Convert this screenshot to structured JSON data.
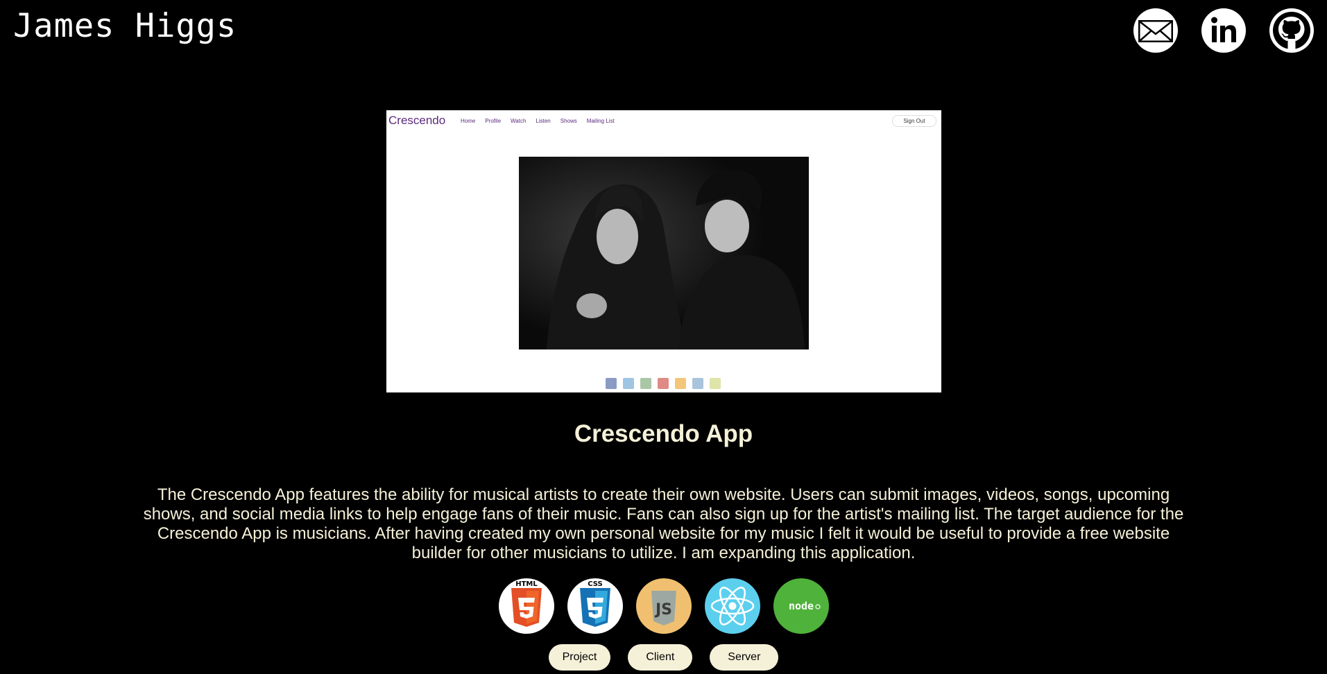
{
  "header": {
    "title": "James Higgs",
    "social": [
      "email-icon",
      "linkedin-icon",
      "github-icon"
    ]
  },
  "screenshot": {
    "brand": "Crescendo",
    "nav": [
      "Home",
      "Profile",
      "Watch",
      "Listen",
      "Shows",
      "Mailing List"
    ],
    "sign_out": "Sign Out",
    "footer_icons": [
      "facebook-icon",
      "twitter-icon",
      "instagram-icon",
      "youtube-icon",
      "soundcloud-icon",
      "bandcamp-icon",
      "mail-icon"
    ]
  },
  "project": {
    "title": "Crescendo App",
    "description": "The Crescendo App features the ability for musical artists to create their own website. Users can submit images, videos, songs, upcoming shows, and social media links to help engage fans of their music. Fans can also sign up for the artist's mailing list. The target audience for the Crescendo App is musicians. After having created my own personal website for my music I felt it would be useful to provide a free website builder for other musicians to utilize. I am expanding this application.",
    "tech": [
      "html5-icon",
      "css3-icon",
      "javascript-icon",
      "react-icon",
      "nodejs-icon"
    ],
    "tech_labels": {
      "html": "HTML",
      "css": "CSS",
      "js": "JS",
      "node": "node"
    },
    "links": [
      "Project",
      "Client",
      "Server"
    ]
  },
  "colors": {
    "background": "#000000",
    "text": "#f5f1d8",
    "pill": "#f5f1d8",
    "brand": "#5c2a7e"
  }
}
